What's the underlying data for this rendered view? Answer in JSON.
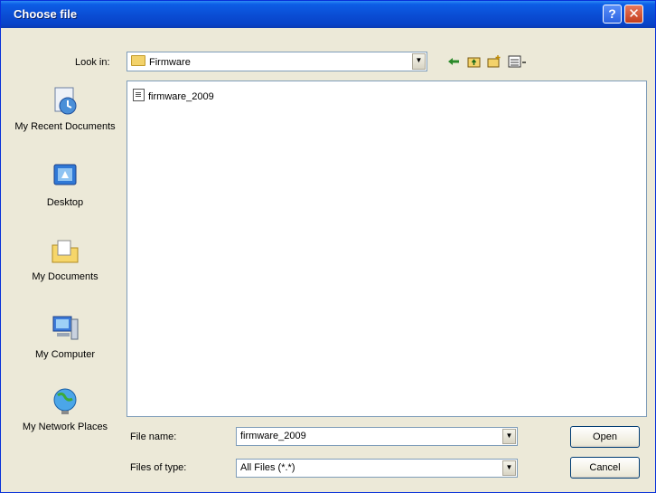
{
  "window": {
    "title": "Choose file"
  },
  "titlebar": {
    "help_label": "?",
    "close_label": "✕"
  },
  "look_in": {
    "label": "Look in:",
    "value": "Firmware"
  },
  "places": [
    {
      "label": "My Recent Documents"
    },
    {
      "label": "Desktop"
    },
    {
      "label": "My Documents"
    },
    {
      "label": "My Computer"
    },
    {
      "label": "My Network Places"
    }
  ],
  "files": [
    {
      "name": "firmware_2009"
    }
  ],
  "file_name": {
    "label": "File name:",
    "value": "firmware_2009"
  },
  "file_type": {
    "label": "Files of type:",
    "value": "All Files (*.*)"
  },
  "buttons": {
    "open": "Open",
    "cancel": "Cancel"
  },
  "colors": {
    "titlebar": "#0a4cd3",
    "face": "#ece9d8",
    "border": "#7f9db9"
  }
}
